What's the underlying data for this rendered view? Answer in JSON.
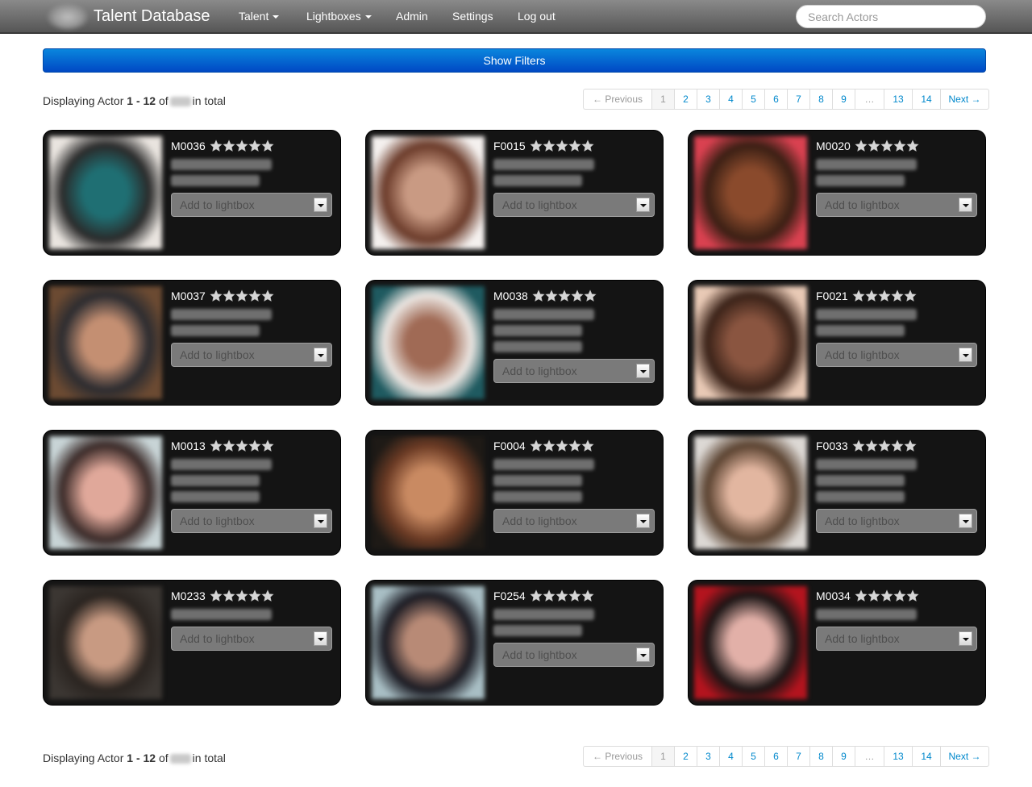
{
  "navbar": {
    "brand": "Talent Database",
    "logo_icon": "blurred-logo",
    "items": [
      {
        "label": "Talent",
        "dropdown": true
      },
      {
        "label": "Lightboxes",
        "dropdown": true
      },
      {
        "label": "Admin",
        "dropdown": false
      },
      {
        "label": "Settings",
        "dropdown": false
      },
      {
        "label": "Log out",
        "dropdown": false
      }
    ],
    "search_placeholder": "Search Actors"
  },
  "filters": {
    "button_label": "Show Filters"
  },
  "display": {
    "prefix": "Displaying Actor",
    "range": "1 - 12",
    "of": "of",
    "total": "(blurred)",
    "suffix": "in total"
  },
  "pagination": {
    "previous": "← Previous",
    "pages": [
      "1",
      "2",
      "3",
      "4",
      "5",
      "6",
      "7",
      "8",
      "9",
      "…",
      "13",
      "14"
    ],
    "active_page": "1",
    "next": "Next →"
  },
  "lightbox_placeholder": "Add to lightbox",
  "actors": [
    {
      "code": "M0036",
      "rating": 5,
      "detail_lines": 2,
      "photo_colors": [
        "#e9e4df",
        "#2a2a2a",
        "#1f6f73"
      ]
    },
    {
      "code": "F0015",
      "rating": 5,
      "detail_lines": 2,
      "photo_colors": [
        "#f4f0ee",
        "#6b3b2a",
        "#c99a83"
      ]
    },
    {
      "code": "M0020",
      "rating": 5,
      "detail_lines": 2,
      "photo_colors": [
        "#d94150",
        "#3a1f14",
        "#8a4a2c"
      ]
    },
    {
      "code": "M0037",
      "rating": 5,
      "detail_lines": 2,
      "photo_colors": [
        "#6b4a32",
        "#2c2c30",
        "#c48f72"
      ]
    },
    {
      "code": "M0038",
      "rating": 5,
      "detail_lines": 3,
      "photo_colors": [
        "#1f5a60",
        "#ebe6e2",
        "#a06a55"
      ]
    },
    {
      "code": "F0021",
      "rating": 5,
      "detail_lines": 2,
      "photo_colors": [
        "#e8c9b5",
        "#3a2218",
        "#8a5540"
      ]
    },
    {
      "code": "M0013",
      "rating": 5,
      "detail_lines": 3,
      "photo_colors": [
        "#c8d4d6",
        "#3a2a28",
        "#e0a89a"
      ]
    },
    {
      "code": "F0004",
      "rating": 5,
      "detail_lines": 3,
      "photo_colors": [
        "#1e1a16",
        "#6a3a24",
        "#c98a62"
      ]
    },
    {
      "code": "F0033",
      "rating": 5,
      "detail_lines": 3,
      "photo_colors": [
        "#dcd8d4",
        "#5a4230",
        "#e2b6a0"
      ]
    },
    {
      "code": "M0233",
      "rating": 5,
      "detail_lines": 1,
      "photo_colors": [
        "#3b3632",
        "#2a2420",
        "#c89a82"
      ]
    },
    {
      "code": "F0254",
      "rating": 5,
      "detail_lines": 2,
      "photo_colors": [
        "#a8bec4",
        "#1a1a22",
        "#b88a76"
      ]
    },
    {
      "code": "M0034",
      "rating": 5,
      "detail_lines": 1,
      "photo_colors": [
        "#b3141e",
        "#1a1414",
        "#e2b0a8"
      ]
    }
  ]
}
